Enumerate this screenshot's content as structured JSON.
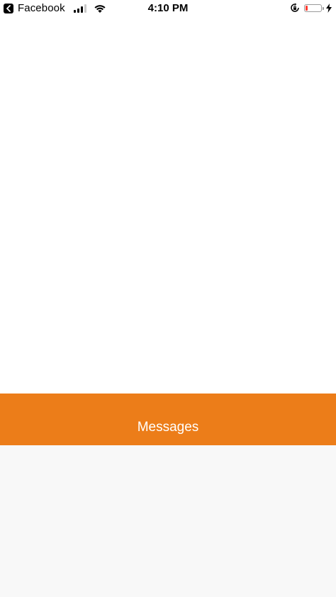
{
  "status_bar": {
    "back_app_label": "Facebook",
    "time": "4:10 PM",
    "battery_level": 0.15,
    "battery_color": "#ff3b30",
    "signal_bars_filled": 3,
    "signal_bars_total": 4
  },
  "messages_bar": {
    "title": "Messages",
    "background_color": "#ec7d19"
  },
  "colors": {
    "screen_background": "#ffffff",
    "lower_panel_background": "#f8f8f8"
  }
}
